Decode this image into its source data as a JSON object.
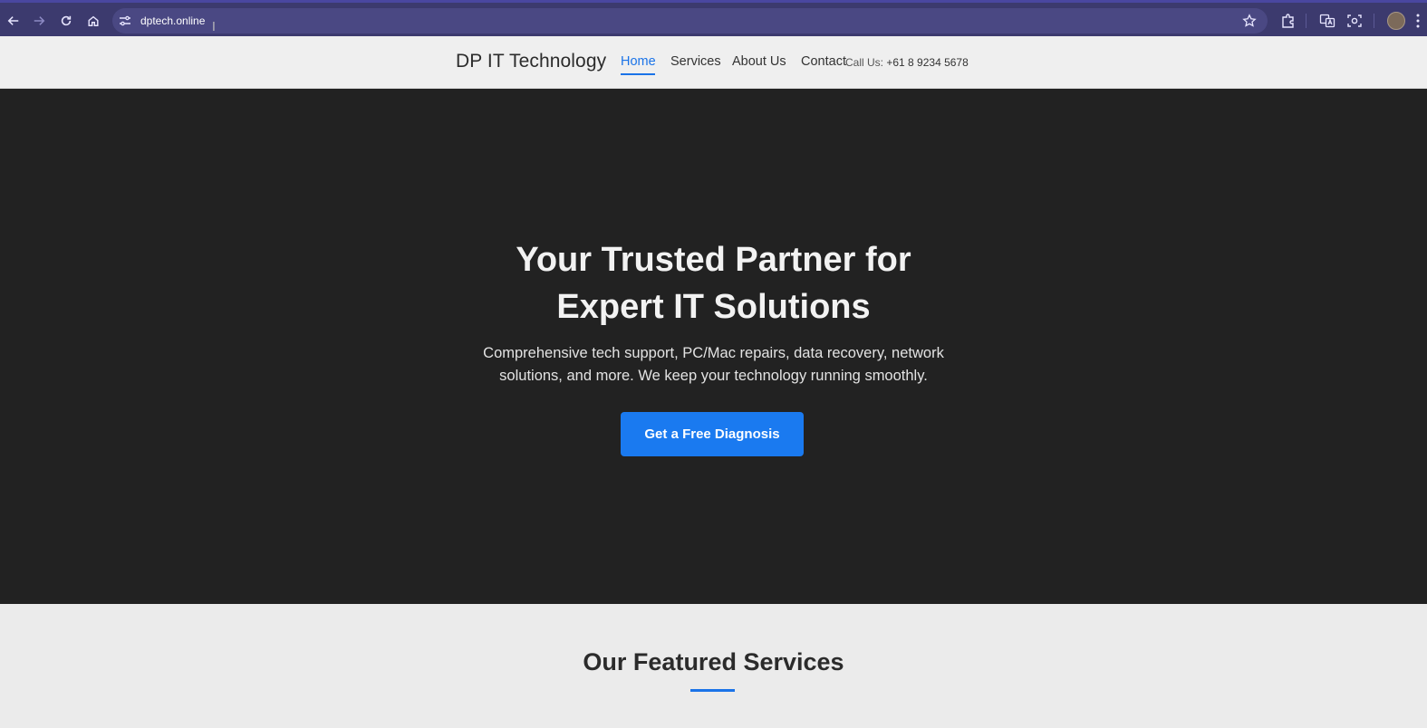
{
  "browser": {
    "url": "dptech.online"
  },
  "header": {
    "brand": "DP IT Technology",
    "nav": [
      {
        "label": "Home"
      },
      {
        "label": "Services"
      },
      {
        "label": "About Us"
      },
      {
        "label": "Contact"
      }
    ],
    "call_label": "Call Us:",
    "call_number": "+61 8 9234 5678"
  },
  "hero": {
    "title_line1": "Your Trusted Partner for",
    "title_line2": "Expert IT Solutions",
    "subtitle_line1": "Comprehensive tech support, PC/Mac repairs, data recovery, network",
    "subtitle_line2": "solutions, and more. We keep your technology running smoothly.",
    "cta_label": "Get a Free Diagnosis"
  },
  "featured": {
    "title": "Our Featured Services"
  },
  "colors": {
    "accent": "#1a73e8",
    "cta": "#1a7af0",
    "hero_bg": "#222222",
    "browser_bar": "#3c3a6e"
  },
  "icons": [
    "back-arrow-icon",
    "forward-arrow-icon",
    "reload-icon",
    "home-icon",
    "site-settings-icon",
    "bookmark-star-icon",
    "extensions-icon",
    "translate-icon",
    "screenshot-icon",
    "profile-avatar",
    "menu-dots-icon"
  ]
}
